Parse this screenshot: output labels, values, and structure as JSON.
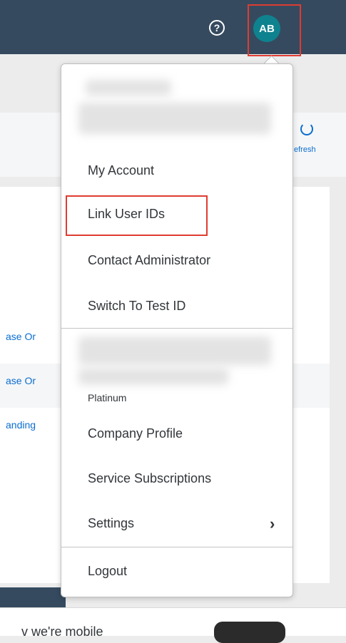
{
  "header": {
    "help_icon": "?",
    "avatar_initials": "AB",
    "colors": {
      "bar": "#354a5f",
      "avatar": "#0f828f",
      "highlight": "#e03c31"
    }
  },
  "background_page": {
    "refresh_label": "efresh",
    "link_1": "ase Or",
    "link_2": "ase Or",
    "link_3": "anding",
    "mobile_text": "v we're mobile"
  },
  "user_menu": {
    "items": [
      {
        "label": "My Account"
      },
      {
        "label": "Link User IDs"
      },
      {
        "label": "Contact Administrator"
      },
      {
        "label": "Switch To Test ID"
      }
    ],
    "account_tier": "Platinum",
    "company_items": [
      {
        "label": "Company Profile"
      },
      {
        "label": "Service Subscriptions"
      },
      {
        "label": "Settings"
      }
    ],
    "logout_label": "Logout"
  }
}
